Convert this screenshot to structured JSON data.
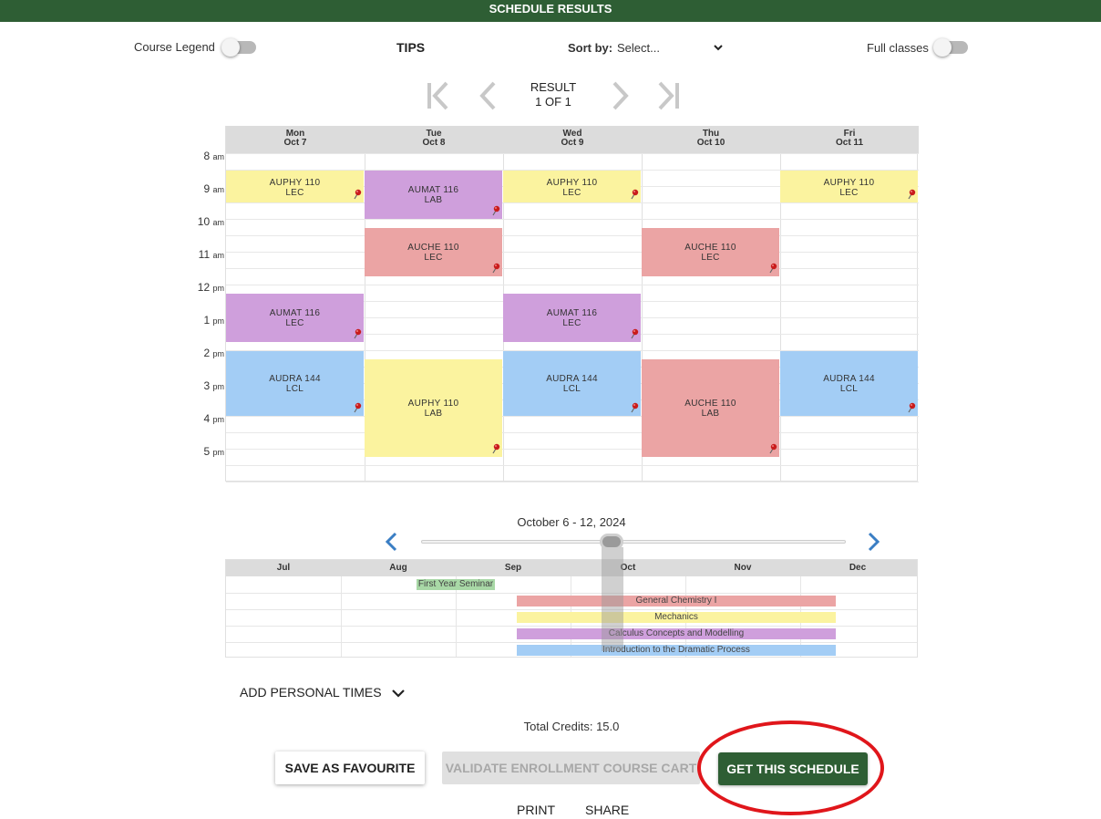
{
  "header": {
    "title": "SCHEDULE RESULTS"
  },
  "controls": {
    "course_legend_label": "Course Legend",
    "tips_label": "TIPS",
    "sort_label": "Sort by:",
    "sort_value": "Select...",
    "full_classes_label": "Full classes"
  },
  "result": {
    "line1": "RESULT",
    "line2": "1 OF 1"
  },
  "calendar": {
    "days": [
      {
        "day": "Mon",
        "date": "Oct 7"
      },
      {
        "day": "Tue",
        "date": "Oct 8"
      },
      {
        "day": "Wed",
        "date": "Oct 9"
      },
      {
        "day": "Thu",
        "date": "Oct 10"
      },
      {
        "day": "Fri",
        "date": "Oct 11"
      }
    ],
    "hours": [
      {
        "num": "8",
        "suffix": "am"
      },
      {
        "num": "9",
        "suffix": "am"
      },
      {
        "num": "10",
        "suffix": "am"
      },
      {
        "num": "11",
        "suffix": "am"
      },
      {
        "num": "12",
        "suffix": "pm"
      },
      {
        "num": "1",
        "suffix": "pm"
      },
      {
        "num": "2",
        "suffix": "pm"
      },
      {
        "num": "3",
        "suffix": "pm"
      },
      {
        "num": "4",
        "suffix": "pm"
      },
      {
        "num": "5",
        "suffix": "pm"
      }
    ],
    "events": [
      {
        "course": "AUPHY 110",
        "type": "LEC"
      },
      {
        "course": "AUMAT 116",
        "type": "LAB"
      },
      {
        "course": "AUPHY 110",
        "type": "LEC"
      },
      {
        "course": "AUPHY 110",
        "type": "LEC"
      },
      {
        "course": "AUCHE 110",
        "type": "LEC"
      },
      {
        "course": "AUCHE 110",
        "type": "LEC"
      },
      {
        "course": "AUMAT 116",
        "type": "LEC"
      },
      {
        "course": "AUMAT 116",
        "type": "LEC"
      },
      {
        "course": "AUDRA 144",
        "type": "LCL"
      },
      {
        "course": "AUPHY 110",
        "type": "LAB"
      },
      {
        "course": "AUDRA 144",
        "type": "LCL"
      },
      {
        "course": "AUCHE 110",
        "type": "LAB"
      },
      {
        "course": "AUDRA 144",
        "type": "LCL"
      }
    ]
  },
  "week_selector": {
    "date_range": "October 6 - 12, 2024"
  },
  "timeline": {
    "months": [
      "Jul",
      "Aug",
      "Sep",
      "Oct",
      "Nov",
      "Dec"
    ],
    "courses": [
      "First Year Seminar",
      "General Chemistry I",
      "Mechanics",
      "Calculus Concepts and Modelling",
      "Introduction to the Dramatic Process"
    ]
  },
  "personal_times": {
    "label": "ADD PERSONAL TIMES"
  },
  "credits": {
    "label": "Total Credits: 15.0"
  },
  "buttons": {
    "save_favourite": "SAVE AS FAVOURITE",
    "validate_cart": "VALIDATE ENROLLMENT COURSE CART",
    "get_schedule": "GET THIS SCHEDULE",
    "print": "PRINT",
    "share": "SHARE"
  },
  "colors": {
    "brand_green": "#2e5e34",
    "physics": "#fbf39f",
    "math": "#cf9fdc",
    "chemistry": "#eba4a4",
    "drama": "#a3cdf5",
    "seminar": "#a8d8a6",
    "highlight_circle": "#e0161b"
  },
  "icons": {
    "first_page": "first-page-icon",
    "prev_page": "chevron-left-icon",
    "next_page": "chevron-right-icon",
    "last_page": "last-page-icon",
    "pin": "pushpin-icon",
    "expand": "chevron-down-icon"
  }
}
